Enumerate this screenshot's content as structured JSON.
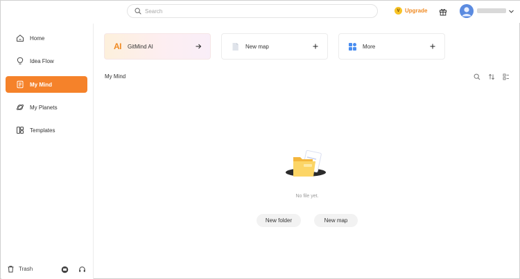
{
  "topbar": {
    "search_placeholder": "Search",
    "upgrade_label": "Upgrade",
    "upgrade_badge": "V",
    "brand_color": "#f5822a"
  },
  "sidebar": {
    "items": [
      {
        "label": "Home",
        "icon": "home-icon"
      },
      {
        "label": "Idea Flow",
        "icon": "lightbulb-icon"
      },
      {
        "label": "My Mind",
        "icon": "document-icon",
        "active": true
      },
      {
        "label": "My Planets",
        "icon": "planet-icon"
      },
      {
        "label": "Templates",
        "icon": "templates-icon"
      }
    ],
    "trash_label": "Trash"
  },
  "cards": {
    "ai": {
      "label": "GitMind AI",
      "mark": "AI"
    },
    "new_map": {
      "label": "New map"
    },
    "more": {
      "label": "More"
    }
  },
  "main": {
    "section_title": "My Mind",
    "empty_text": "No file yet.",
    "new_folder_label": "New folder",
    "new_map_label": "New map"
  }
}
